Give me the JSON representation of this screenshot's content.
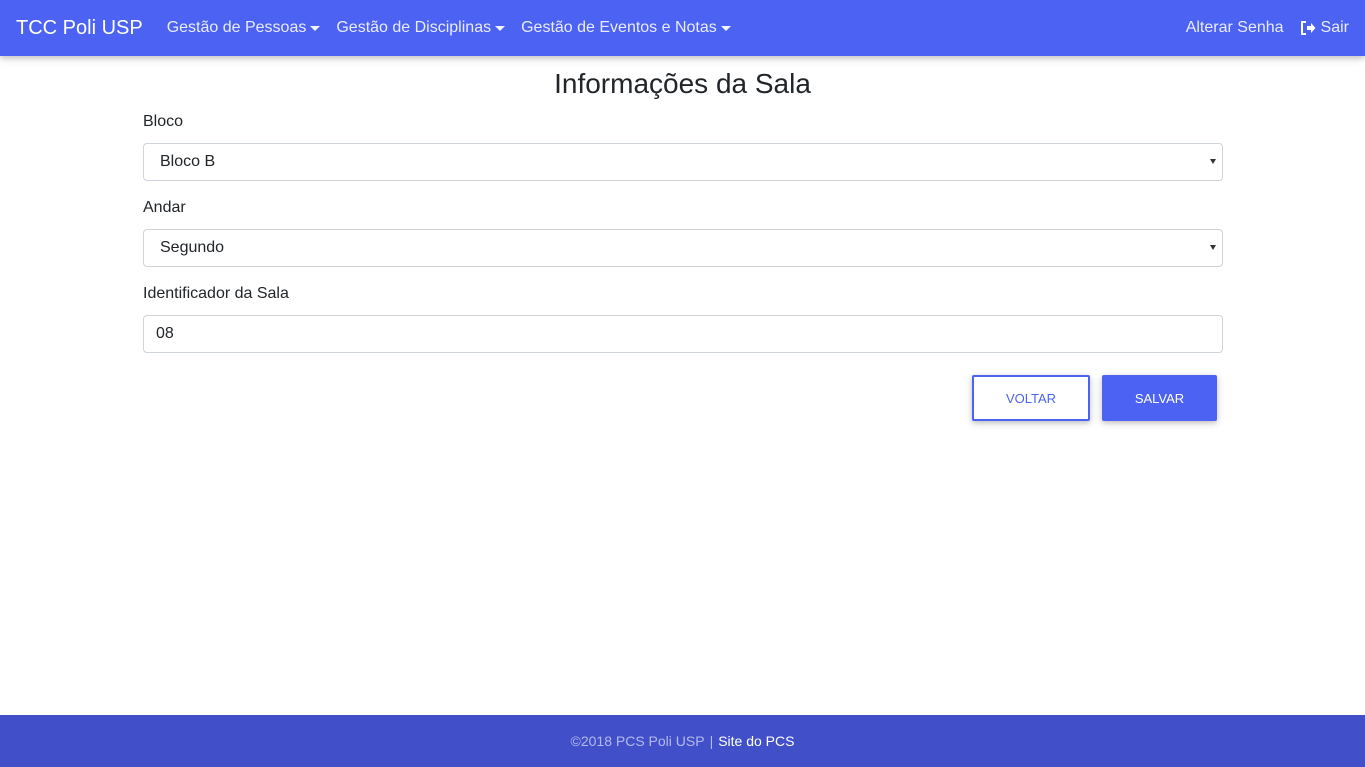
{
  "navbar": {
    "brand": "TCC Poli USP",
    "menus": [
      {
        "label": "Gestão de Pessoas"
      },
      {
        "label": "Gestão de Disciplinas"
      },
      {
        "label": "Gestão de Eventos e Notas"
      }
    ],
    "change_password": "Alterar Senha",
    "signout": "Sair",
    "colors": {
      "background": "#4c62f2"
    }
  },
  "page": {
    "title": "Informações da Sala"
  },
  "form": {
    "bloco": {
      "label": "Bloco",
      "value": "Bloco B"
    },
    "andar": {
      "label": "Andar",
      "value": "Segundo"
    },
    "identificador": {
      "label": "Identificador da Sala",
      "value": "08"
    }
  },
  "actions": {
    "back": "VOLTAR",
    "save": "SALVAR"
  },
  "footer": {
    "copyright": "©2018 PCS Poli USP",
    "separator": "|",
    "link": "Site do PCS",
    "background": "#414fc9"
  }
}
